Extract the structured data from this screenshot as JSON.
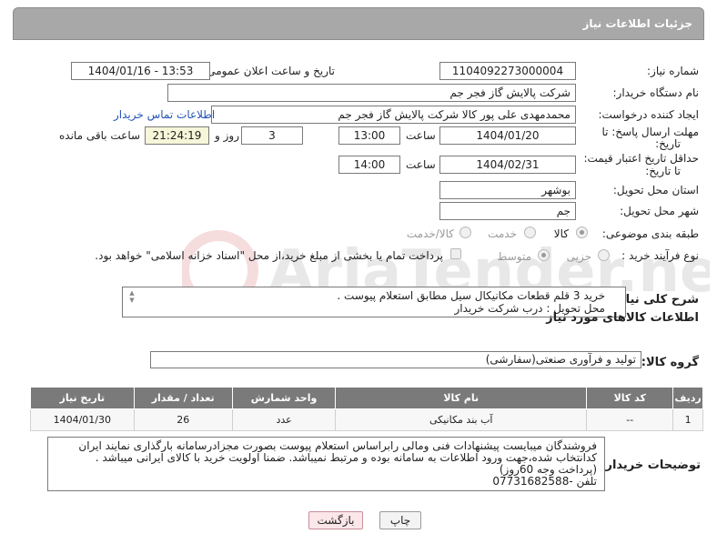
{
  "header": {
    "title": "جزئیات اطلاعات نیاز"
  },
  "form": {
    "need_number_label": "شماره نیاز:",
    "need_number": "1104092273000004",
    "announce_label": "تاریخ و ساعت اعلان عمومی:",
    "announce_value": "1404/01/16 - 13:53",
    "buyer_org_label": "نام دستگاه خریدار:",
    "buyer_org": "شرکت پالایش گاز فجر جم",
    "creator_label": "ایجاد کننده درخواست:",
    "creator": "محمدمهدی علی پور کالا شرکت پالایش گاز فجر جم",
    "contact_link": "اطلاعات تماس خریدار",
    "reply_deadline_label_1": "مهلت ارسال پاسخ: تا",
    "reply_deadline_label_2": "تاریخ:",
    "reply_date": "1404/01/20",
    "time_label": "ساعت",
    "reply_time": "13:00",
    "days": "3",
    "days_label": "روز و",
    "remaining_time": "21:24:19",
    "remaining_label": "ساعت باقی مانده",
    "price_validity_label_1": "حداقل تاریخ اعتبار قیمت:",
    "price_validity_label_2": "تا تاریخ:",
    "price_date": "1404/02/31",
    "price_time": "14:00",
    "province_label": "استان محل تحویل:",
    "province": "بوشهر",
    "city_label": "شهر محل تحویل:",
    "city": "جم",
    "category_label": "طبقه بندی موضوعی:",
    "category_options": [
      "کالا",
      "خدمت",
      "کالا/خدمت"
    ],
    "category_selected": "کالا",
    "process_label": "نوع فرآیند خرید :",
    "process_options": [
      "جزیی",
      "متوسط"
    ],
    "process_selected": "متوسط",
    "payment_note": "پرداخت تمام یا بخشی از مبلغ خرید،از محل \"اسناد خزانه اسلامی\" خواهد بود.",
    "description_label": "شرح کلی نیاز:",
    "description_line1": "خرید 3 قلم قطعات مکانیکال سیل مطابق استعلام پیوست .",
    "description_line2": "محل تحویل : درب شرکت خریدار"
  },
  "goods_section": {
    "title": "اطلاعات کالاهای مورد نیاز",
    "group_label": "گروه کالا:",
    "group_value": "تولید و فرآوری صنعتی(سفارشی)",
    "columns": [
      "ردیف",
      "کد کالا",
      "نام کالا",
      "واحد شمارش",
      "تعداد / مقدار",
      "تاریخ نیاز"
    ],
    "rows": [
      [
        "1",
        "--",
        "آب بند مکانیکی",
        "عدد",
        "26",
        "1404/01/30"
      ]
    ]
  },
  "buyer_notes": {
    "label": "توضیحات خریدار:",
    "lines": [
      "فروشندگان میبایست پیشنهادات فنی ومالی رابراساس استعلام پیوست بصورت مجزادرسامانه بارگذاری نمایند ایران",
      "کدانتخاب شده،جهت ورود اطلاعات به سامانه بوده و مرتبط نمیباشد. ضمنا اولویت خرید با کالای ایرانی میباشد .",
      "(پرداخت وجه 60روز)",
      "تلفن -07731682588"
    ]
  },
  "buttons": {
    "print": "چاپ",
    "back": "بازگشت"
  },
  "watermark": {
    "text": "AriaTender.neT"
  }
}
